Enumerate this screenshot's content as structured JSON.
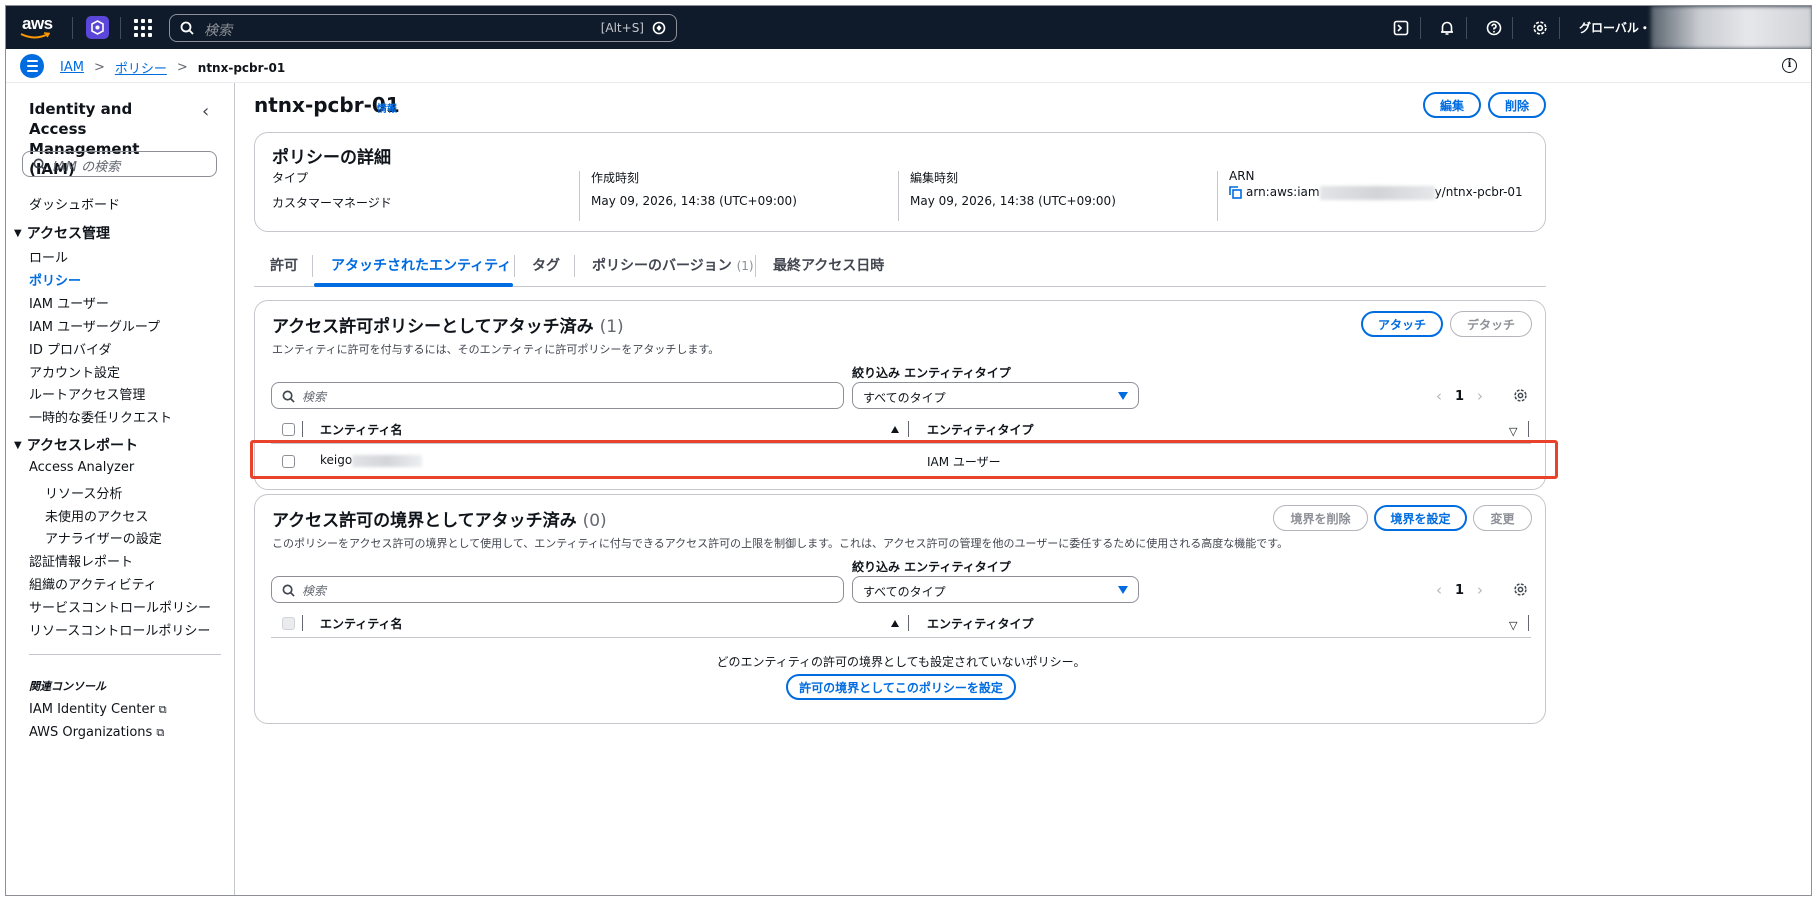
{
  "topnav": {
    "logo": "aws",
    "search_placeholder": "検索",
    "search_shortcut": "[Alt+S]",
    "region": "グローバル・",
    "icons": [
      "cloudshell-icon",
      "bell-icon",
      "help-icon",
      "gear-icon"
    ]
  },
  "breadcrumb": {
    "items": [
      "IAM",
      "ポリシー"
    ],
    "current": "ntnx-pcbr-01"
  },
  "sidebar": {
    "title": "Identity and Access Management (IAM)",
    "search_placeholder": "IAM の検索",
    "dashboard": "ダッシュボード",
    "access_mgmt": "アクセス管理",
    "access_mgmt_items": [
      "ロール",
      "ポリシー",
      "IAM ユーザー",
      "IAM ユーザーグループ",
      "ID プロバイダ",
      "アカウント設定",
      "ルートアクセス管理",
      "一時的な委任リクエスト"
    ],
    "access_reports": "アクセスレポート",
    "analyzer": "Access Analyzer",
    "analyzer_items": [
      "リソース分析",
      "未使用のアクセス",
      "アナライザーの設定"
    ],
    "report_items": [
      "認証情報レポート",
      "組織のアクティビティ",
      "サービスコントロールポリシー",
      "リソースコントロールポリシー"
    ],
    "related_label": "関連コンソール",
    "related_items": [
      "IAM Identity Center",
      "AWS Organizations"
    ]
  },
  "page": {
    "title": "ntnx-pcbr-01",
    "info": "情報",
    "edit_button": "編集",
    "delete_button": "削除"
  },
  "details": {
    "heading": "ポリシーの詳細",
    "type_label": "タイプ",
    "type_value": "カスタマーマネージド",
    "created_label": "作成時刻",
    "created_value": "May 09, 2026, 14:38 (UTC+09:00)",
    "edited_label": "編集時刻",
    "edited_value": "May 09, 2026, 14:38 (UTC+09:00)",
    "arn_label": "ARN",
    "arn_prefix": "arn:aws:iam",
    "arn_suffix": "y/ntnx-pcbr-01"
  },
  "tabs": [
    {
      "label": "許可"
    },
    {
      "label": "アタッチされたエンティティ",
      "active": true
    },
    {
      "label": "タグ"
    },
    {
      "label": "ポリシーのバージョン",
      "count": "(1)"
    },
    {
      "label": "最終アクセス日時"
    }
  ],
  "permissions_section": {
    "title": "アクセス許可ポリシーとしてアタッチ済み",
    "count": "(1)",
    "description": "エンティティに許可を付与するには、そのエンティティに許可ポリシーをアタッチします。",
    "attach_button": "アタッチ",
    "detach_button": "デタッチ",
    "filter_label": "絞り込み エンティティタイプ",
    "search_placeholder": "検索",
    "select_value": "すべてのタイプ",
    "page": "1",
    "columns": [
      "エンティティ名",
      "エンティティタイプ"
    ],
    "rows": [
      {
        "name": "keigo",
        "type": "IAM ユーザー"
      }
    ]
  },
  "boundary_section": {
    "title": "アクセス許可の境界としてアタッチ済み",
    "count": "(0)",
    "description": "このポリシーをアクセス許可の境界として使用して、エンティティに付与できるアクセス許可の上限を制御します。これは、アクセス許可の管理を他のユーザーに委任するために使用される高度な機能です。",
    "remove_button": "境界を削除",
    "set_button": "境界を設定",
    "change_button": "変更",
    "filter_label": "絞り込み エンティティタイプ",
    "search_placeholder": "検索",
    "select_value": "すべてのタイプ",
    "page": "1",
    "columns": [
      "エンティティ名",
      "エンティティタイプ"
    ],
    "empty_text": "どのエンティティの許可の境界としても設定されていないポリシー。",
    "empty_button": "許可の境界としてこのポリシーを設定"
  },
  "colors": {
    "accent": "#006ce0",
    "nav_bg": "#0f1b2a",
    "highlight": "#e8432a"
  }
}
